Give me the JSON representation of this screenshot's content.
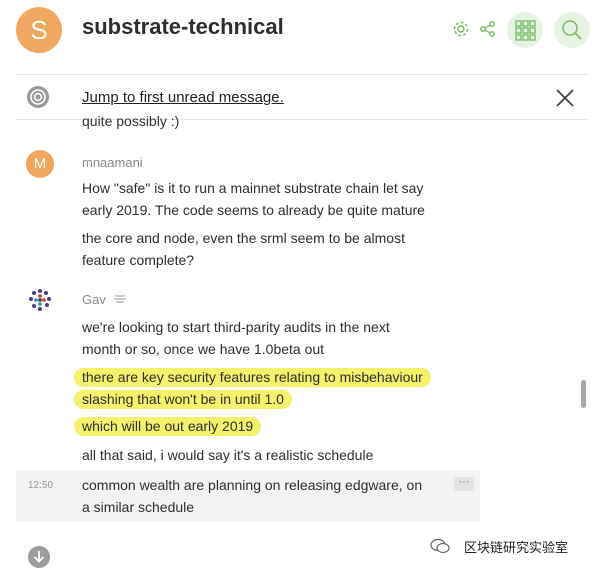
{
  "header": {
    "avatar_letter": "S",
    "room_name": "substrate-technical",
    "accent_color": "#7bbf6a"
  },
  "jumpbar": {
    "label": "Jump to first unread message."
  },
  "timeline": {
    "clipped_previous": "quite possibly :)",
    "messages": [
      {
        "avatar_letter": "M",
        "sender": "mnaamani",
        "lines": [
          "How \"safe\" is it to run a mainnet substrate chain let say",
          "early 2019. The code seems to already be quite mature",
          "the core and node, even the srml seem to be almost",
          "feature complete?"
        ]
      },
      {
        "sender": "Gav",
        "lines": [
          "we're looking to start third-parity audits in the next",
          "month or so, once we have 1.0beta out",
          "there are key security features relating to misbehaviour",
          "slashing that won't be in until 1.0",
          "which will be out early 2019",
          "all that said, i would say it's a realistic schedule"
        ],
        "followup": {
          "timestamp": "12:50",
          "lines": [
            "common wealth are planning on releasing edgware, on",
            "a similar schedule"
          ]
        }
      }
    ]
  },
  "watermark": {
    "text": "区块链研究实验室"
  }
}
